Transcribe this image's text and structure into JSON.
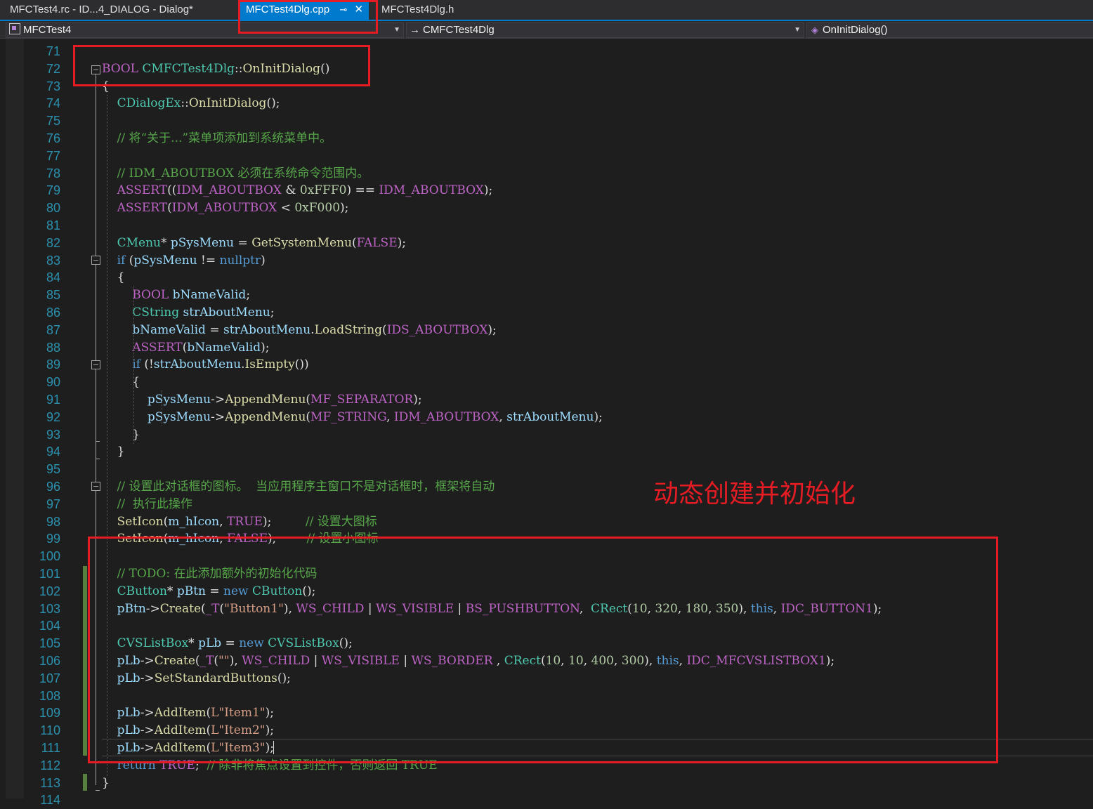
{
  "tabs": [
    {
      "label": "MFCTest4.rc - ID...4_DIALOG - Dialog*",
      "active": false
    },
    {
      "label": "MFCTest4Dlg.cpp",
      "active": true
    },
    {
      "label": "MFCTest4Dlg.h",
      "active": false
    }
  ],
  "nav": {
    "project": "MFCTest4",
    "class": "CMFCTest4Dlg",
    "member": "OnInitDialog()"
  },
  "colors": {
    "keyword": "#569cd6",
    "type": "#4ec9b0",
    "function": "#dcdcaa",
    "variable": "#9cdcfe",
    "comment": "#57a64a",
    "string": "#d69d85",
    "number": "#b5cea8",
    "macro": "#bd63c5",
    "line_number": "#2b91af",
    "annotation": "#e51c23",
    "accent": "#007acc"
  },
  "annotation": "动态创建并初始化",
  "lines": [
    {
      "n": "71",
      "tokens": []
    },
    {
      "n": "72",
      "tokens": [
        {
          "t": "BOOL",
          "c": "mac"
        },
        {
          "t": " ",
          "c": "plain"
        },
        {
          "t": "CMFCTest4Dlg",
          "c": "type"
        },
        {
          "t": "::",
          "c": "plain"
        },
        {
          "t": "OnInitDialog",
          "c": "fn"
        },
        {
          "t": "()",
          "c": "plain"
        }
      ]
    },
    {
      "n": "73",
      "tokens": [
        {
          "t": "{",
          "c": "plain"
        }
      ]
    },
    {
      "n": "74",
      "tokens": [
        {
          "t": "    ",
          "c": "plain"
        },
        {
          "t": "CDialogEx",
          "c": "type"
        },
        {
          "t": "::",
          "c": "plain"
        },
        {
          "t": "OnInitDialog",
          "c": "fn"
        },
        {
          "t": "();",
          "c": "plain"
        }
      ]
    },
    {
      "n": "75",
      "tokens": []
    },
    {
      "n": "76",
      "tokens": [
        {
          "t": "    // 将“关于...”菜单项添加到系统菜单中。",
          "c": "cmt"
        }
      ]
    },
    {
      "n": "77",
      "tokens": []
    },
    {
      "n": "78",
      "tokens": [
        {
          "t": "    // IDM_ABOUTBOX 必须在系统命令范围内。",
          "c": "cmt"
        }
      ]
    },
    {
      "n": "79",
      "tokens": [
        {
          "t": "    ",
          "c": "plain"
        },
        {
          "t": "ASSERT",
          "c": "mac"
        },
        {
          "t": "((",
          "c": "plain"
        },
        {
          "t": "IDM_ABOUTBOX",
          "c": "mac"
        },
        {
          "t": " & ",
          "c": "plain"
        },
        {
          "t": "0xFFF0",
          "c": "num"
        },
        {
          "t": ") == ",
          "c": "plain"
        },
        {
          "t": "IDM_ABOUTBOX",
          "c": "mac"
        },
        {
          "t": ");",
          "c": "plain"
        }
      ]
    },
    {
      "n": "80",
      "tokens": [
        {
          "t": "    ",
          "c": "plain"
        },
        {
          "t": "ASSERT",
          "c": "mac"
        },
        {
          "t": "(",
          "c": "plain"
        },
        {
          "t": "IDM_ABOUTBOX",
          "c": "mac"
        },
        {
          "t": " < ",
          "c": "plain"
        },
        {
          "t": "0xF000",
          "c": "num"
        },
        {
          "t": ");",
          "c": "plain"
        }
      ]
    },
    {
      "n": "81",
      "tokens": []
    },
    {
      "n": "82",
      "tokens": [
        {
          "t": "    ",
          "c": "plain"
        },
        {
          "t": "CMenu",
          "c": "type"
        },
        {
          "t": "* ",
          "c": "plain"
        },
        {
          "t": "pSysMenu",
          "c": "var"
        },
        {
          "t": " = ",
          "c": "plain"
        },
        {
          "t": "GetSystemMenu",
          "c": "fn"
        },
        {
          "t": "(",
          "c": "plain"
        },
        {
          "t": "FALSE",
          "c": "mac"
        },
        {
          "t": ");",
          "c": "plain"
        }
      ]
    },
    {
      "n": "83",
      "tokens": [
        {
          "t": "    ",
          "c": "plain"
        },
        {
          "t": "if",
          "c": "kw"
        },
        {
          "t": " (",
          "c": "plain"
        },
        {
          "t": "pSysMenu",
          "c": "var"
        },
        {
          "t": " != ",
          "c": "plain"
        },
        {
          "t": "nullptr",
          "c": "kw"
        },
        {
          "t": ")",
          "c": "plain"
        }
      ]
    },
    {
      "n": "84",
      "tokens": [
        {
          "t": "    {",
          "c": "plain"
        }
      ]
    },
    {
      "n": "85",
      "tokens": [
        {
          "t": "        ",
          "c": "plain"
        },
        {
          "t": "BOOL",
          "c": "mac"
        },
        {
          "t": " ",
          "c": "plain"
        },
        {
          "t": "bNameValid",
          "c": "var"
        },
        {
          "t": ";",
          "c": "plain"
        }
      ]
    },
    {
      "n": "86",
      "tokens": [
        {
          "t": "        ",
          "c": "plain"
        },
        {
          "t": "CString",
          "c": "type"
        },
        {
          "t": " ",
          "c": "plain"
        },
        {
          "t": "strAboutMenu",
          "c": "var"
        },
        {
          "t": ";",
          "c": "plain"
        }
      ]
    },
    {
      "n": "87",
      "tokens": [
        {
          "t": "        ",
          "c": "plain"
        },
        {
          "t": "bNameValid",
          "c": "var"
        },
        {
          "t": " = ",
          "c": "plain"
        },
        {
          "t": "strAboutMenu",
          "c": "var"
        },
        {
          "t": ".",
          "c": "plain"
        },
        {
          "t": "LoadString",
          "c": "fn"
        },
        {
          "t": "(",
          "c": "plain"
        },
        {
          "t": "IDS_ABOUTBOX",
          "c": "mac"
        },
        {
          "t": ");",
          "c": "plain"
        }
      ]
    },
    {
      "n": "88",
      "tokens": [
        {
          "t": "        ",
          "c": "plain"
        },
        {
          "t": "ASSERT",
          "c": "mac"
        },
        {
          "t": "(",
          "c": "plain"
        },
        {
          "t": "bNameValid",
          "c": "var"
        },
        {
          "t": ");",
          "c": "plain"
        }
      ]
    },
    {
      "n": "89",
      "tokens": [
        {
          "t": "        ",
          "c": "plain"
        },
        {
          "t": "if",
          "c": "kw"
        },
        {
          "t": " (!",
          "c": "plain"
        },
        {
          "t": "strAboutMenu",
          "c": "var"
        },
        {
          "t": ".",
          "c": "plain"
        },
        {
          "t": "IsEmpty",
          "c": "fn"
        },
        {
          "t": "())",
          "c": "plain"
        }
      ]
    },
    {
      "n": "90",
      "tokens": [
        {
          "t": "        {",
          "c": "plain"
        }
      ]
    },
    {
      "n": "91",
      "tokens": [
        {
          "t": "            ",
          "c": "plain"
        },
        {
          "t": "pSysMenu",
          "c": "var"
        },
        {
          "t": "->",
          "c": "plain"
        },
        {
          "t": "AppendMenu",
          "c": "fn"
        },
        {
          "t": "(",
          "c": "plain"
        },
        {
          "t": "MF_SEPARATOR",
          "c": "mac"
        },
        {
          "t": ");",
          "c": "plain"
        }
      ]
    },
    {
      "n": "92",
      "tokens": [
        {
          "t": "            ",
          "c": "plain"
        },
        {
          "t": "pSysMenu",
          "c": "var"
        },
        {
          "t": "->",
          "c": "plain"
        },
        {
          "t": "AppendMenu",
          "c": "fn"
        },
        {
          "t": "(",
          "c": "plain"
        },
        {
          "t": "MF_STRING",
          "c": "mac"
        },
        {
          "t": ", ",
          "c": "plain"
        },
        {
          "t": "IDM_ABOUTBOX",
          "c": "mac"
        },
        {
          "t": ", ",
          "c": "plain"
        },
        {
          "t": "strAboutMenu",
          "c": "var"
        },
        {
          "t": ");",
          "c": "plain"
        }
      ]
    },
    {
      "n": "93",
      "tokens": [
        {
          "t": "        }",
          "c": "plain"
        }
      ]
    },
    {
      "n": "94",
      "tokens": [
        {
          "t": "    }",
          "c": "plain"
        }
      ]
    },
    {
      "n": "95",
      "tokens": []
    },
    {
      "n": "96",
      "tokens": [
        {
          "t": "    // 设置此对话框的图标。  当应用程序主窗口不是对话框时，框架将自动",
          "c": "cmt"
        }
      ]
    },
    {
      "n": "97",
      "tokens": [
        {
          "t": "    //  执行此操作",
          "c": "cmt"
        }
      ]
    },
    {
      "n": "98",
      "tokens": [
        {
          "t": "    ",
          "c": "plain"
        },
        {
          "t": "SetIcon",
          "c": "fn"
        },
        {
          "t": "(",
          "c": "plain"
        },
        {
          "t": "m_hIcon",
          "c": "var"
        },
        {
          "t": ", ",
          "c": "plain"
        },
        {
          "t": "TRUE",
          "c": "mac"
        },
        {
          "t": ");         ",
          "c": "plain"
        },
        {
          "t": "// 设置大图标",
          "c": "cmt"
        }
      ]
    },
    {
      "n": "99",
      "tokens": [
        {
          "t": "    ",
          "c": "plain"
        },
        {
          "t": "SetIcon",
          "c": "fn"
        },
        {
          "t": "(",
          "c": "plain"
        },
        {
          "t": "m_hIcon",
          "c": "var"
        },
        {
          "t": ", ",
          "c": "plain"
        },
        {
          "t": "FALSE",
          "c": "mac"
        },
        {
          "t": ");        ",
          "c": "plain"
        },
        {
          "t": "// 设置小图标",
          "c": "cmt"
        }
      ]
    },
    {
      "n": "100",
      "tokens": []
    },
    {
      "n": "101",
      "tokens": [
        {
          "t": "    // TODO: 在此添加额外的初始化代码",
          "c": "cmt"
        }
      ]
    },
    {
      "n": "102",
      "tokens": [
        {
          "t": "    ",
          "c": "plain"
        },
        {
          "t": "CButton",
          "c": "type"
        },
        {
          "t": "* ",
          "c": "plain"
        },
        {
          "t": "pBtn",
          "c": "var"
        },
        {
          "t": " = ",
          "c": "plain"
        },
        {
          "t": "new",
          "c": "kw"
        },
        {
          "t": " ",
          "c": "plain"
        },
        {
          "t": "CButton",
          "c": "type"
        },
        {
          "t": "();",
          "c": "plain"
        }
      ]
    },
    {
      "n": "103",
      "tokens": [
        {
          "t": "    ",
          "c": "plain"
        },
        {
          "t": "pBtn",
          "c": "var"
        },
        {
          "t": "->",
          "c": "plain"
        },
        {
          "t": "Create",
          "c": "fn"
        },
        {
          "t": "(",
          "c": "plain"
        },
        {
          "t": "_T",
          "c": "mac"
        },
        {
          "t": "(",
          "c": "plain"
        },
        {
          "t": "\"Button1\"",
          "c": "str"
        },
        {
          "t": "), ",
          "c": "plain"
        },
        {
          "t": "WS_CHILD",
          "c": "mac"
        },
        {
          "t": " | ",
          "c": "plain"
        },
        {
          "t": "WS_VISIBLE",
          "c": "mac"
        },
        {
          "t": " | ",
          "c": "plain"
        },
        {
          "t": "BS_PUSHBUTTON",
          "c": "mac"
        },
        {
          "t": ",  ",
          "c": "plain"
        },
        {
          "t": "CRect",
          "c": "type"
        },
        {
          "t": "(",
          "c": "plain"
        },
        {
          "t": "10",
          "c": "num"
        },
        {
          "t": ", ",
          "c": "plain"
        },
        {
          "t": "320",
          "c": "num"
        },
        {
          "t": ", ",
          "c": "plain"
        },
        {
          "t": "180",
          "c": "num"
        },
        {
          "t": ", ",
          "c": "plain"
        },
        {
          "t": "350",
          "c": "num"
        },
        {
          "t": "), ",
          "c": "plain"
        },
        {
          "t": "this",
          "c": "kw"
        },
        {
          "t": ", ",
          "c": "plain"
        },
        {
          "t": "IDC_BUTTON1",
          "c": "mac"
        },
        {
          "t": ");",
          "c": "plain"
        }
      ]
    },
    {
      "n": "104",
      "tokens": []
    },
    {
      "n": "105",
      "tokens": [
        {
          "t": "    ",
          "c": "plain"
        },
        {
          "t": "CVSListBox",
          "c": "type"
        },
        {
          "t": "* ",
          "c": "plain"
        },
        {
          "t": "pLb",
          "c": "var"
        },
        {
          "t": " = ",
          "c": "plain"
        },
        {
          "t": "new",
          "c": "kw"
        },
        {
          "t": " ",
          "c": "plain"
        },
        {
          "t": "CVSListBox",
          "c": "type"
        },
        {
          "t": "();",
          "c": "plain"
        }
      ]
    },
    {
      "n": "106",
      "tokens": [
        {
          "t": "    ",
          "c": "plain"
        },
        {
          "t": "pLb",
          "c": "var"
        },
        {
          "t": "->",
          "c": "plain"
        },
        {
          "t": "Create",
          "c": "fn"
        },
        {
          "t": "(",
          "c": "plain"
        },
        {
          "t": "_T",
          "c": "mac"
        },
        {
          "t": "(",
          "c": "plain"
        },
        {
          "t": "\"\"",
          "c": "str"
        },
        {
          "t": "), ",
          "c": "plain"
        },
        {
          "t": "WS_CHILD",
          "c": "mac"
        },
        {
          "t": " | ",
          "c": "plain"
        },
        {
          "t": "WS_VISIBLE",
          "c": "mac"
        },
        {
          "t": " | ",
          "c": "plain"
        },
        {
          "t": "WS_BORDER",
          "c": "mac"
        },
        {
          "t": " , ",
          "c": "plain"
        },
        {
          "t": "CRect",
          "c": "type"
        },
        {
          "t": "(",
          "c": "plain"
        },
        {
          "t": "10",
          "c": "num"
        },
        {
          "t": ", ",
          "c": "plain"
        },
        {
          "t": "10",
          "c": "num"
        },
        {
          "t": ", ",
          "c": "plain"
        },
        {
          "t": "400",
          "c": "num"
        },
        {
          "t": ", ",
          "c": "plain"
        },
        {
          "t": "300",
          "c": "num"
        },
        {
          "t": "), ",
          "c": "plain"
        },
        {
          "t": "this",
          "c": "kw"
        },
        {
          "t": ", ",
          "c": "plain"
        },
        {
          "t": "IDC_MFCVSLISTBOX1",
          "c": "mac"
        },
        {
          "t": ");",
          "c": "plain"
        }
      ]
    },
    {
      "n": "107",
      "tokens": [
        {
          "t": "    ",
          "c": "plain"
        },
        {
          "t": "pLb",
          "c": "var"
        },
        {
          "t": "->",
          "c": "plain"
        },
        {
          "t": "SetStandardButtons",
          "c": "fn"
        },
        {
          "t": "();",
          "c": "plain"
        }
      ]
    },
    {
      "n": "108",
      "tokens": []
    },
    {
      "n": "109",
      "tokens": [
        {
          "t": "    ",
          "c": "plain"
        },
        {
          "t": "pLb",
          "c": "var"
        },
        {
          "t": "->",
          "c": "plain"
        },
        {
          "t": "AddItem",
          "c": "fn"
        },
        {
          "t": "(",
          "c": "plain"
        },
        {
          "t": "L\"Item1\"",
          "c": "str"
        },
        {
          "t": ");",
          "c": "plain"
        }
      ]
    },
    {
      "n": "110",
      "tokens": [
        {
          "t": "    ",
          "c": "plain"
        },
        {
          "t": "pLb",
          "c": "var"
        },
        {
          "t": "->",
          "c": "plain"
        },
        {
          "t": "AddItem",
          "c": "fn"
        },
        {
          "t": "(",
          "c": "plain"
        },
        {
          "t": "L\"Item2\"",
          "c": "str"
        },
        {
          "t": ");",
          "c": "plain"
        }
      ]
    },
    {
      "n": "111",
      "tokens": [
        {
          "t": "    ",
          "c": "plain"
        },
        {
          "t": "pLb",
          "c": "var"
        },
        {
          "t": "->",
          "c": "plain"
        },
        {
          "t": "AddItem",
          "c": "fn"
        },
        {
          "t": "(",
          "c": "plain"
        },
        {
          "t": "L\"Item3\"",
          "c": "str"
        },
        {
          "t": ");",
          "c": "plain"
        }
      ]
    },
    {
      "n": "112",
      "tokens": [
        {
          "t": "    ",
          "c": "plain"
        },
        {
          "t": "return",
          "c": "kw"
        },
        {
          "t": " ",
          "c": "plain"
        },
        {
          "t": "TRUE",
          "c": "mac"
        },
        {
          "t": ";  ",
          "c": "plain"
        },
        {
          "t": "// 除非将焦点设置到控件，否则返回 TRUE",
          "c": "cmt"
        }
      ]
    },
    {
      "n": "113",
      "tokens": [
        {
          "t": "}",
          "c": "plain"
        }
      ]
    },
    {
      "n": "114",
      "tokens": []
    }
  ]
}
